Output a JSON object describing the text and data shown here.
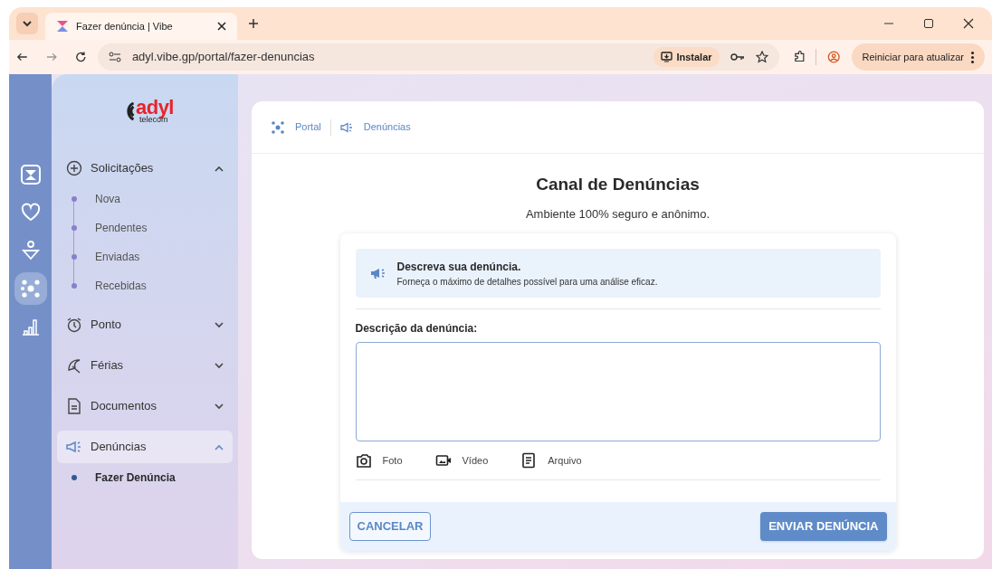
{
  "browser": {
    "tab_title": "Fazer denúncia | Vibe",
    "url": "adyl.vibe.gp/portal/fazer-denuncias",
    "install_label": "Instalar",
    "restart_label": "Reiniciar para atualizar"
  },
  "logo": {
    "text": "adyl",
    "sub": "telecom"
  },
  "rail": [
    {
      "selected": false
    },
    {
      "selected": false
    },
    {
      "selected": false
    },
    {
      "selected": true
    },
    {
      "selected": false
    }
  ],
  "sidebar": {
    "groups": [
      {
        "label": "Solicitações",
        "expanded": true,
        "selected": false,
        "children": [
          {
            "label": "Nova",
            "selected": false
          },
          {
            "label": "Pendentes",
            "selected": false
          },
          {
            "label": "Enviadas",
            "selected": false
          },
          {
            "label": "Recebidas",
            "selected": false
          }
        ]
      },
      {
        "label": "Ponto",
        "expanded": false,
        "selected": false
      },
      {
        "label": "Férias",
        "expanded": false,
        "selected": false
      },
      {
        "label": "Documentos",
        "expanded": false,
        "selected": false
      },
      {
        "label": "Denúncias",
        "expanded": true,
        "selected": true,
        "children": [
          {
            "label": "Fazer Denúncia",
            "selected": true
          }
        ]
      }
    ]
  },
  "breadcrumb": [
    "Portal",
    "Denúncias"
  ],
  "title": "Canal de Denúncias",
  "subtitle": "Ambiente 100% seguro e anônimo.",
  "info": {
    "title": "Descreva sua denúncia.",
    "text": "Forneça o máximo de detalhes possível para uma análise eficaz."
  },
  "field": {
    "label": "Descrição da denúncia:"
  },
  "attachments": [
    "Foto",
    "Vídeo",
    "Arquivo"
  ],
  "buttons": {
    "cancel": "CANCELAR",
    "submit": "ENVIAR DENÚNCIA"
  }
}
